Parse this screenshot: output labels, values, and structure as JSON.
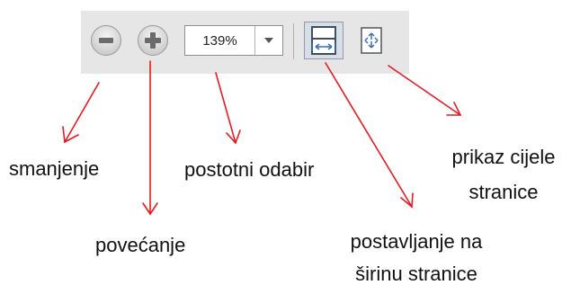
{
  "toolbar": {
    "zoom_value": "139%",
    "icons": [
      "zoom-out-icon",
      "zoom-in-icon",
      "dropdown-chevron-icon",
      "fit-width-icon",
      "fit-page-icon"
    ]
  },
  "labels": {
    "zoom_out": "smanjenje",
    "zoom_in": "povećanje",
    "zoom_percent": "postotni odabir",
    "fit_page_line1": "prikaz cijele",
    "fit_page_line2": "stranice",
    "fit_width_line1": "postavljanje na",
    "fit_width_line2": "širinu stranice"
  },
  "colors": {
    "toolbar_bg": "#e6e6e6",
    "arrow": "#e8191f",
    "text": "#111111"
  }
}
